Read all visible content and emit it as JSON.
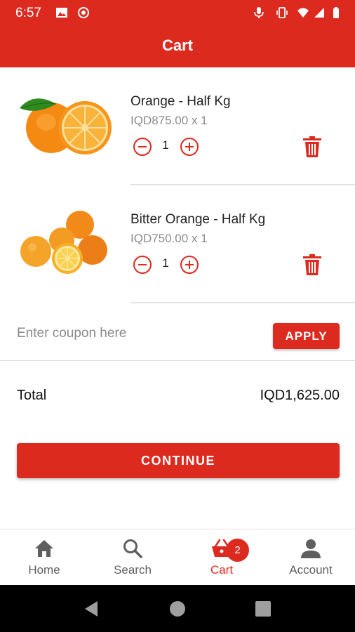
{
  "statusbar": {
    "time": "6:57"
  },
  "appbar": {
    "title": "Cart"
  },
  "cart_items": [
    {
      "name": "Orange - Half Kg",
      "price": "IQD875.00 x 1",
      "qty": "1"
    },
    {
      "name": "Bitter Orange - Half Kg",
      "price": "IQD750.00 x 1",
      "qty": "1"
    }
  ],
  "coupon": {
    "placeholder": "Enter coupon here",
    "value": "",
    "apply_label": "APPLY"
  },
  "total": {
    "label": "Total",
    "value": "IQD1,625.00"
  },
  "continue_label": "CONTINUE",
  "bottom_nav": {
    "items": [
      {
        "label": "Home",
        "icon": "home-icon"
      },
      {
        "label": "Search",
        "icon": "search-icon"
      },
      {
        "label": "Cart",
        "icon": "cart-icon",
        "active": true
      },
      {
        "label": "Account",
        "icon": "account-icon"
      }
    ],
    "cart_badge": "2"
  },
  "colors": {
    "primary": "#dd2a1f",
    "muted_text": "#8a8a8a",
    "nav_inactive": "#5f5f5f"
  }
}
